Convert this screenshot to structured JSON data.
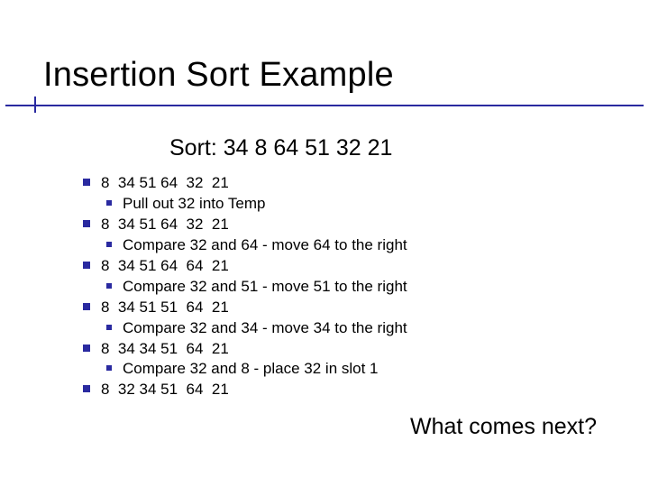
{
  "title": "Insertion Sort Example",
  "subtitle": "Sort: 34  8  64  51  32  21",
  "steps": [
    {
      "array": "8  34 51 64  32  21",
      "note": "Pull out 32 into Temp"
    },
    {
      "array": "8  34 51 64  32  21",
      "note": "Compare 32 and 64 - move 64 to the right"
    },
    {
      "array": "8  34 51 64  64  21",
      "note": "Compare 32 and 51 - move 51 to the right"
    },
    {
      "array": "8  34 51 51  64  21",
      "note": "Compare 32 and 34 - move 34 to the right"
    },
    {
      "array": "8  34 34 51  64  21",
      "note": "Compare 32 and 8 - place 32 in slot 1"
    },
    {
      "array": "8  32 34 51  64  21",
      "note": null
    }
  ],
  "footer": "What comes next?",
  "colors": {
    "accent": "#2a2aa0"
  }
}
